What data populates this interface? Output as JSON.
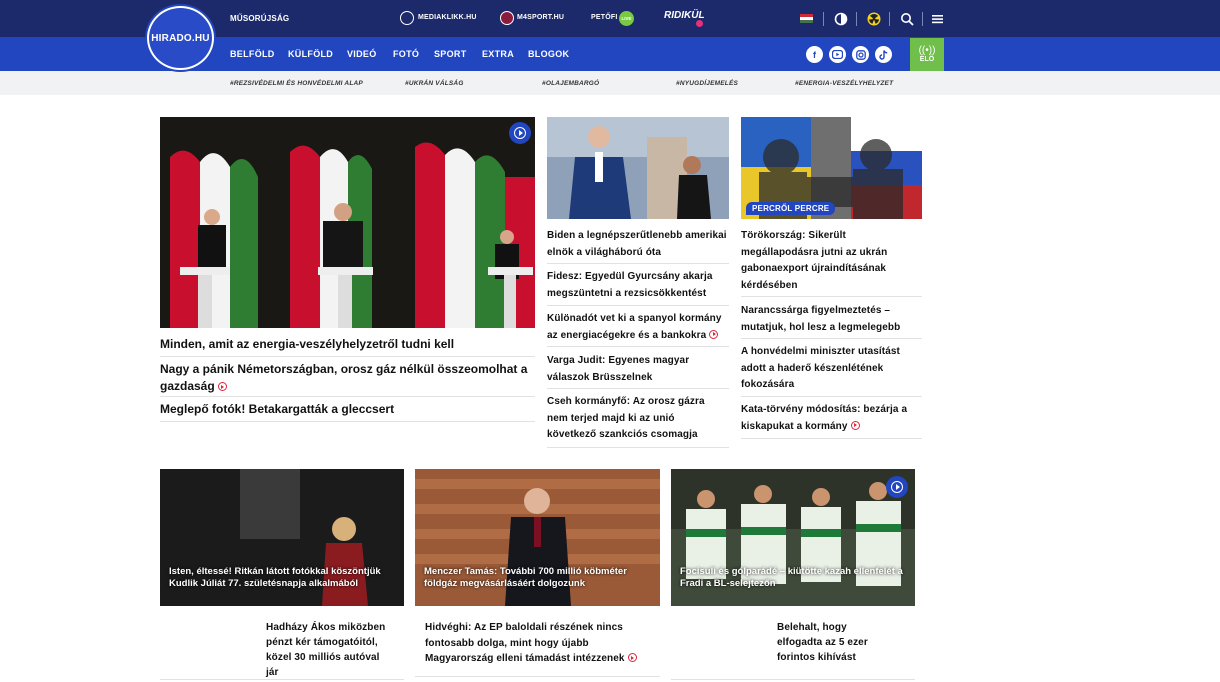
{
  "header": {
    "logo_text": "HIRADO.HU",
    "musor_link": "MŰSORÚJSÁG",
    "mediaklikk": "MEDIAKLIKK.HU",
    "m4sport": "M4SPORT.HU",
    "petofi": "PETŐFI",
    "petofi_live": "LIVE",
    "ridikul": "RIDIKÜL",
    "icons": [
      "hungarian-flag-icon",
      "brightness-icon",
      "radiation-icon",
      "search-icon",
      "menu-icon"
    ]
  },
  "nav": {
    "items": [
      "BELFÖLD",
      "KÜLFÖLD",
      "VIDEÓ",
      "FOTÓ",
      "SPORT",
      "EXTRA",
      "BLOGOK"
    ],
    "social": [
      "facebook-icon",
      "youtube-icon",
      "instagram-icon",
      "tiktok-icon"
    ],
    "live_label": "ÉLŐ"
  },
  "tags": [
    "#REZSIVÉDELMI ÉS HONVÉDELMI ALAP",
    "#UKRÁN VÁLSÁG",
    "#OLAJEMBARGÓ",
    "#NYUGDÍJEMELÉS",
    "#ENERGIA-VESZÉLYHELYZET"
  ],
  "lead": {
    "main_headline": "Minden, amit az energia-veszélyhelyzetről tudni kell",
    "secondary": [
      "Nagy a pánik Németországban, orosz gáz nélkül összeomolhat a gazdaság",
      "Meglepő fotók! Betakargatták a gleccsert"
    ]
  },
  "middle_column": [
    "Biden a legnépszerűtlenebb amerikai elnök a világháború óta",
    "Fidesz: Egyedül Gyurcsány akarja megszüntetni a rezsicsökkentést",
    "Különadót vet ki a spanyol kormány az energiacégekre és a bankokra",
    "Varga Judit: Egyenes magyar válaszok Brüsszelnek",
    "Cseh kormányfő: Az orosz gázra nem terjed majd ki az unió következő szankciós csomagja"
  ],
  "right_column": {
    "badge": "PERCRŐL PERCRE",
    "items": [
      "Törökország: Sikerült megállapodásra jutni az ukrán gabonaexport újraindításának kérdésében",
      "Narancssárga figyelmeztetés – mutatjuk, hol lesz a legmelegebb",
      "A honvédelmi miniszter utasítást adott a haderő készenlétének fokozására",
      "Kata-törvény módosítás: bezárja a kiskapukat a kormány"
    ]
  },
  "cards": [
    "Isten, éltessé! Ritkán látott fotókkal köszöntjük Kudlik Júliát 77. születésnapja alkalmából",
    "Menczer Tamás: További 700 millió köbméter földgáz megvásárlásáért dolgozunk",
    "Focisuli és gólparádé – kiütötte kazah ellenfelét a Fradi a BL-selejtezőn"
  ],
  "bottom_items": [
    "Hadházy Ákos miközben pénzt kér támogatóitól, közel 30 milliós autóval jár",
    "Hidvéghi: Az EP baloldali részének nincs fontosabb dolga, mint hogy újabb Magyarország elleni támadást intézzenek",
    "Belehalt, hogy elfogadta az 5 ezer forintos kihívást"
  ]
}
